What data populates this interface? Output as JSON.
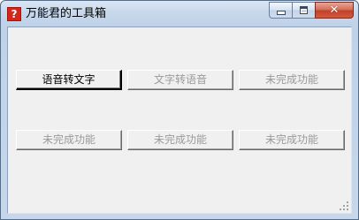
{
  "window": {
    "title": "万能君的工具箱",
    "icon": "question-mark-icon",
    "icon_glyph": "?",
    "caption": {
      "close_glyph": "✕"
    }
  },
  "buttons": [
    {
      "label": "语音转文字",
      "enabled": true
    },
    {
      "label": "文字转语音",
      "enabled": false
    },
    {
      "label": "未完成功能",
      "enabled": false
    },
    {
      "label": "未完成功能",
      "enabled": false
    },
    {
      "label": "未完成功能",
      "enabled": false
    },
    {
      "label": "未完成功能",
      "enabled": false
    }
  ],
  "colors": {
    "title_bar": "#c9d9ec",
    "client_background": "#f0f0f0",
    "disabled_text": "#9a9a9a",
    "close_button": "#c0412a",
    "app_icon": "#d6261b"
  }
}
